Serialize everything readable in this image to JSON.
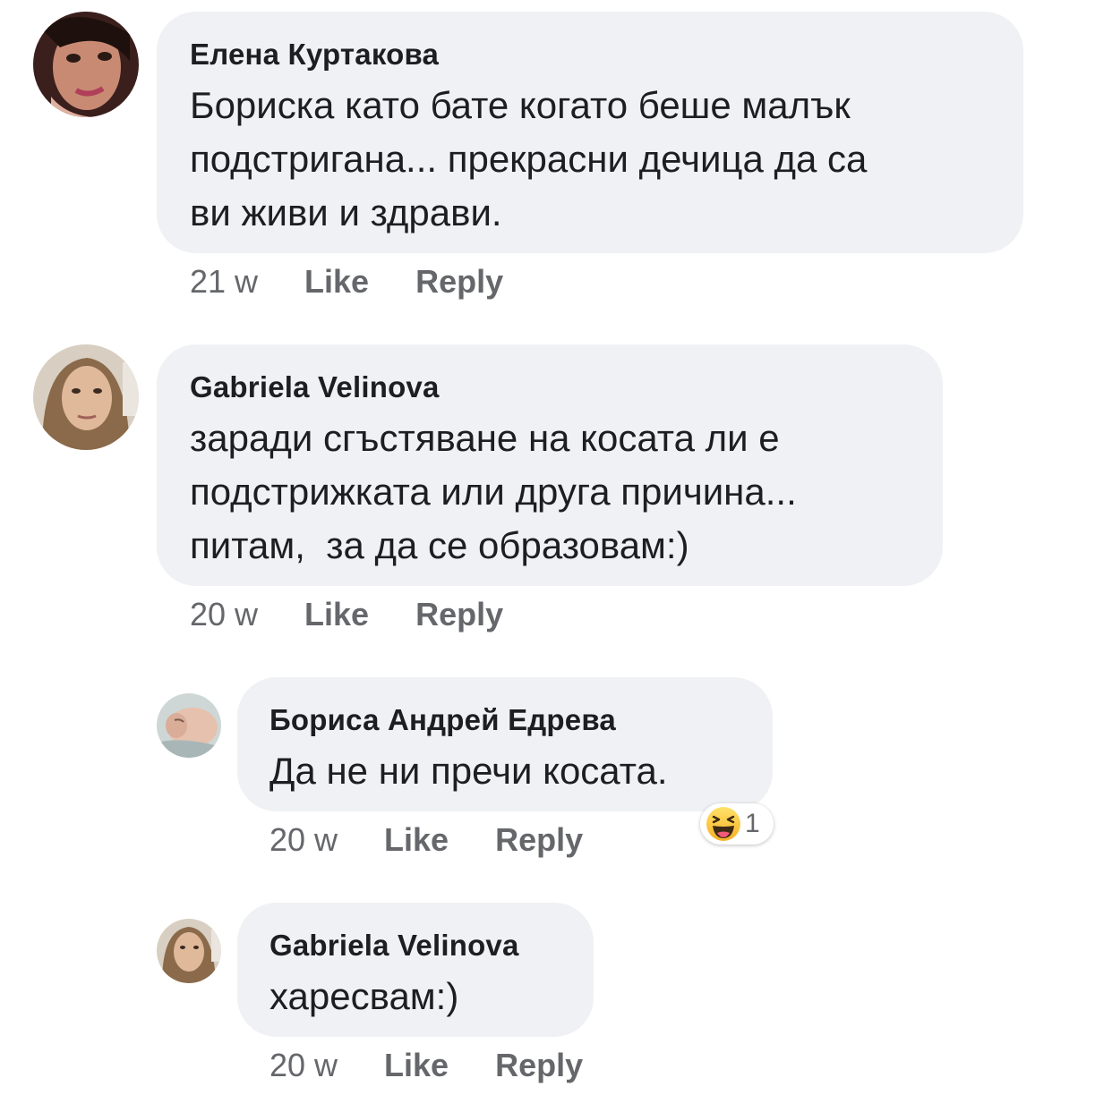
{
  "comments": [
    {
      "author": "Елена Куртакова",
      "lines": [
        "Бориска като бате когато беше малък",
        "подстригана... прекрасни дечица да са",
        "ви живи и здрави."
      ],
      "time": "21 w",
      "like_label": "Like",
      "reply_label": "Reply"
    },
    {
      "author": "Gabriela Velinova",
      "lines": [
        "заради сгъстяване на косата ли е",
        "подстрижката или друга причина...",
        "питам,  за да се образовам:)"
      ],
      "time": "20 w",
      "like_label": "Like",
      "reply_label": "Reply"
    },
    {
      "author": "Бориса Андрей Едрева",
      "lines": [
        "Да не ни пречи косата."
      ],
      "time": "20 w",
      "like_label": "Like",
      "reply_label": "Reply",
      "reaction": {
        "icon": "haha-emoji-icon",
        "count": "1"
      }
    },
    {
      "author": "Gabriela Velinova",
      "lines": [
        "харесвам:)"
      ],
      "time": "20 w",
      "like_label": "Like",
      "reply_label": "Reply"
    }
  ],
  "colors": {
    "bubble": "#f0f1f4",
    "text": "#1c1e21",
    "meta": "#65676b"
  }
}
